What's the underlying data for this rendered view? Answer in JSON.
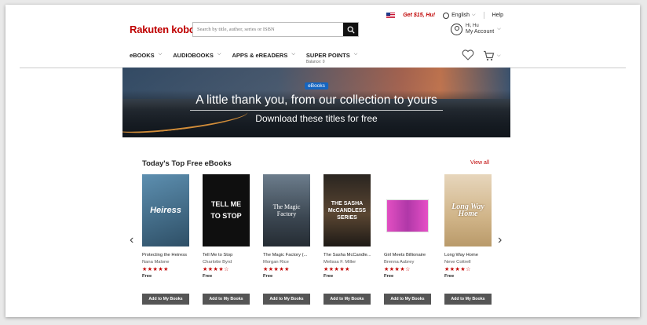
{
  "utility": {
    "promo": "Get $15, Hu!",
    "language": "English",
    "help": "Help"
  },
  "header": {
    "logo": "Rakuten kobo",
    "search_placeholder": "Search by title, author, series or ISBN",
    "account_greeting": "Hi, Hu",
    "account_label": "My Account"
  },
  "nav": {
    "ebooks": "eBOOKS",
    "audiobooks": "AUDIOBOOKS",
    "apps": "APPS & eREADERS",
    "super_points": "SUPER POINTS",
    "balance": "Balance: 0"
  },
  "banner": {
    "badge": "eBooks",
    "title": "A little thank you, from our collection to yours",
    "subtitle": "Download these titles for free"
  },
  "section": {
    "title": "Today's Top Free eBooks",
    "view_all": "View all"
  },
  "books": [
    {
      "title": "Protecting the Heiress",
      "author": "Nana Malone",
      "stars": "★★★★★",
      "price": "Free",
      "button": "Add to My Books",
      "cover_text": "Heiress",
      "cover_color": "#3f6f8f"
    },
    {
      "title": "Tell Me to Stop",
      "author": "Charlotte Byrd",
      "stars": "★★★★☆",
      "price": "Free",
      "button": "Add to My Books",
      "cover_text": "TELL ME TO STOP",
      "cover_color": "#0f0f0f"
    },
    {
      "title": "The Magic Factory (...",
      "author": "Morgan Rice",
      "stars": "★★★★★",
      "price": "Free",
      "button": "Add to My Books",
      "cover_text": "The Magic Factory",
      "cover_color": "#4b5a68"
    },
    {
      "title": "The Sasha McCandle...",
      "author": "Melissa F. Miller",
      "stars": "★★★★★",
      "price": "Free",
      "button": "Add to My Books",
      "cover_text": "THE SASHA McCANDLESS SERIES",
      "cover_color": "#3a2b1e"
    },
    {
      "title": "Girl Meets Billionaire",
      "author": "Brenna Aubrey",
      "stars": "★★★★☆",
      "price": "Free",
      "button": "Add to My Books",
      "cover_text": "",
      "cover_color": "#ffffff"
    },
    {
      "title": "Long Way Home",
      "author": "Neve Cottrell",
      "stars": "★★★★☆",
      "price": "Free",
      "button": "Add to My Books",
      "cover_text": "Long Way Home",
      "cover_color": "#d8c3a0"
    }
  ]
}
